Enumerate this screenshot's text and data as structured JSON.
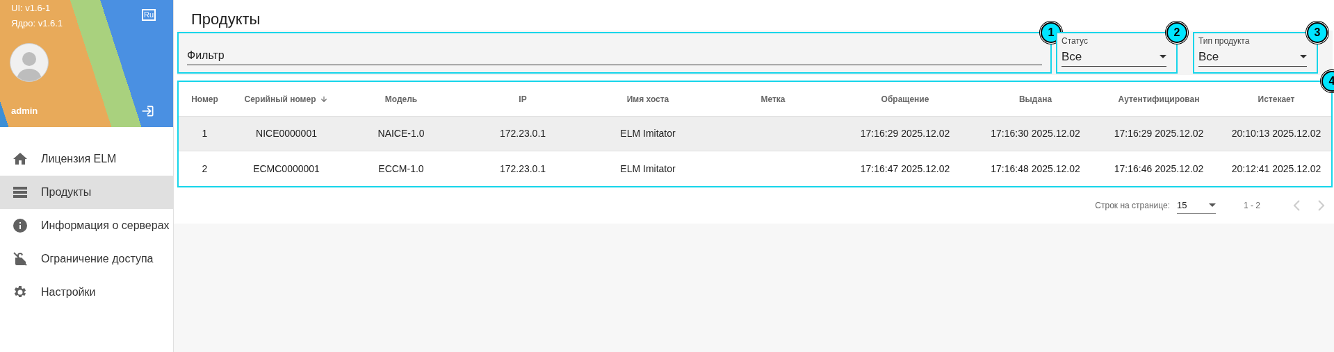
{
  "sidebar": {
    "versions": [
      "UI: v1.6-1",
      "Ядро: v1.6.1"
    ],
    "language": "Ru",
    "user": "admin",
    "items": [
      {
        "label": "Лицензия ELM",
        "selected": false
      },
      {
        "label": "Продукты",
        "selected": true
      },
      {
        "label": "Информация о серверах",
        "selected": false
      },
      {
        "label": "Ограничение доступа",
        "selected": false
      },
      {
        "label": "Настройки",
        "selected": false
      }
    ]
  },
  "page_title": "Продукты",
  "filter": {
    "placeholder": "Фильтр",
    "badge": "1"
  },
  "selects": [
    {
      "label": "Статус",
      "value": "Все",
      "badge": "2"
    },
    {
      "label": "Тип продукта",
      "value": "Все",
      "badge": "3"
    }
  ],
  "table": {
    "badge": "4",
    "columns": [
      {
        "label": "Номер",
        "sorted": false
      },
      {
        "label": "Серийный номер",
        "sorted": true
      },
      {
        "label": "Модель",
        "sorted": false
      },
      {
        "label": "IP",
        "sorted": false
      },
      {
        "label": "Имя хоста",
        "sorted": false
      },
      {
        "label": "Метка",
        "sorted": false
      },
      {
        "label": "Обращение",
        "sorted": false
      },
      {
        "label": "Выдана",
        "sorted": false
      },
      {
        "label": "Аутентифицирован",
        "sorted": false
      },
      {
        "label": "Истекает",
        "sorted": false
      }
    ],
    "rows": [
      {
        "selected": true,
        "cells": [
          "1",
          "NICE0000001",
          "NAICE-1.0",
          "172.23.0.1",
          "ELM Imitator",
          "",
          "17:16:29 2025.12.02",
          "17:16:30 2025.12.02",
          "17:16:29 2025.12.02",
          "20:10:13 2025.12.02"
        ]
      },
      {
        "selected": false,
        "cells": [
          "2",
          "ECMC0000001",
          "ECCM-1.0",
          "172.23.0.1",
          "ELM Imitator",
          "",
          "17:16:47 2025.12.02",
          "17:16:48 2025.12.02",
          "17:16:46 2025.12.02",
          "20:12:41 2025.12.02"
        ]
      }
    ]
  },
  "pagination": {
    "label": "Строк на странице:",
    "per_page": "15",
    "range": "1 - 2"
  }
}
